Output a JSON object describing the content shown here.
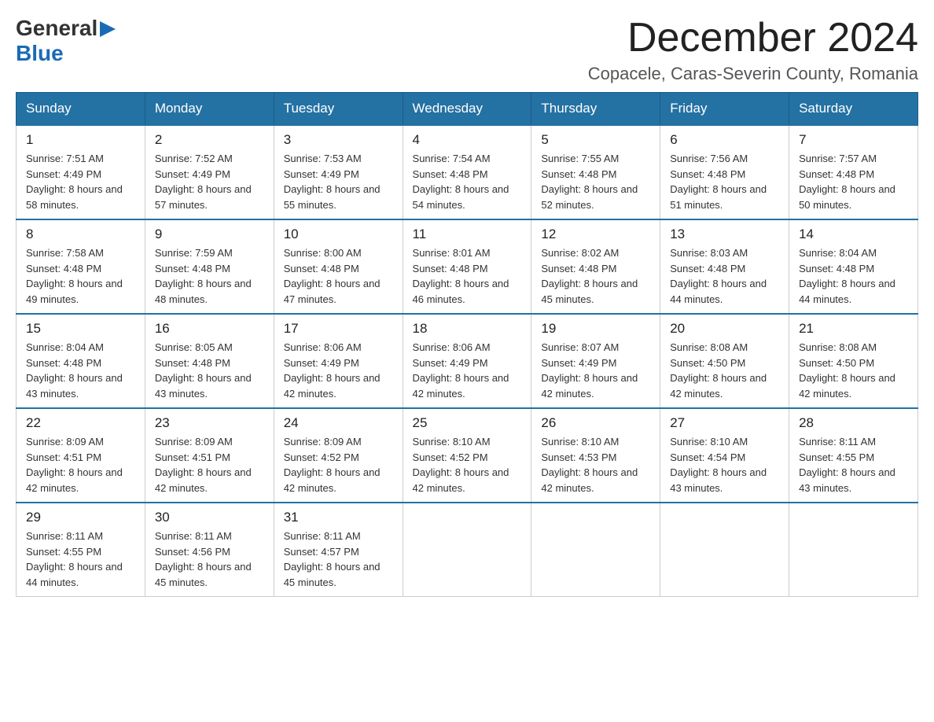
{
  "header": {
    "logo_general": "General",
    "logo_blue": "Blue",
    "month_title": "December 2024",
    "location": "Copacele, Caras-Severin County, Romania"
  },
  "weekdays": [
    "Sunday",
    "Monday",
    "Tuesday",
    "Wednesday",
    "Thursday",
    "Friday",
    "Saturday"
  ],
  "weeks": [
    [
      {
        "day": "1",
        "sunrise": "Sunrise: 7:51 AM",
        "sunset": "Sunset: 4:49 PM",
        "daylight": "Daylight: 8 hours and 58 minutes."
      },
      {
        "day": "2",
        "sunrise": "Sunrise: 7:52 AM",
        "sunset": "Sunset: 4:49 PM",
        "daylight": "Daylight: 8 hours and 57 minutes."
      },
      {
        "day": "3",
        "sunrise": "Sunrise: 7:53 AM",
        "sunset": "Sunset: 4:49 PM",
        "daylight": "Daylight: 8 hours and 55 minutes."
      },
      {
        "day": "4",
        "sunrise": "Sunrise: 7:54 AM",
        "sunset": "Sunset: 4:48 PM",
        "daylight": "Daylight: 8 hours and 54 minutes."
      },
      {
        "day": "5",
        "sunrise": "Sunrise: 7:55 AM",
        "sunset": "Sunset: 4:48 PM",
        "daylight": "Daylight: 8 hours and 52 minutes."
      },
      {
        "day": "6",
        "sunrise": "Sunrise: 7:56 AM",
        "sunset": "Sunset: 4:48 PM",
        "daylight": "Daylight: 8 hours and 51 minutes."
      },
      {
        "day": "7",
        "sunrise": "Sunrise: 7:57 AM",
        "sunset": "Sunset: 4:48 PM",
        "daylight": "Daylight: 8 hours and 50 minutes."
      }
    ],
    [
      {
        "day": "8",
        "sunrise": "Sunrise: 7:58 AM",
        "sunset": "Sunset: 4:48 PM",
        "daylight": "Daylight: 8 hours and 49 minutes."
      },
      {
        "day": "9",
        "sunrise": "Sunrise: 7:59 AM",
        "sunset": "Sunset: 4:48 PM",
        "daylight": "Daylight: 8 hours and 48 minutes."
      },
      {
        "day": "10",
        "sunrise": "Sunrise: 8:00 AM",
        "sunset": "Sunset: 4:48 PM",
        "daylight": "Daylight: 8 hours and 47 minutes."
      },
      {
        "day": "11",
        "sunrise": "Sunrise: 8:01 AM",
        "sunset": "Sunset: 4:48 PM",
        "daylight": "Daylight: 8 hours and 46 minutes."
      },
      {
        "day": "12",
        "sunrise": "Sunrise: 8:02 AM",
        "sunset": "Sunset: 4:48 PM",
        "daylight": "Daylight: 8 hours and 45 minutes."
      },
      {
        "day": "13",
        "sunrise": "Sunrise: 8:03 AM",
        "sunset": "Sunset: 4:48 PM",
        "daylight": "Daylight: 8 hours and 44 minutes."
      },
      {
        "day": "14",
        "sunrise": "Sunrise: 8:04 AM",
        "sunset": "Sunset: 4:48 PM",
        "daylight": "Daylight: 8 hours and 44 minutes."
      }
    ],
    [
      {
        "day": "15",
        "sunrise": "Sunrise: 8:04 AM",
        "sunset": "Sunset: 4:48 PM",
        "daylight": "Daylight: 8 hours and 43 minutes."
      },
      {
        "day": "16",
        "sunrise": "Sunrise: 8:05 AM",
        "sunset": "Sunset: 4:48 PM",
        "daylight": "Daylight: 8 hours and 43 minutes."
      },
      {
        "day": "17",
        "sunrise": "Sunrise: 8:06 AM",
        "sunset": "Sunset: 4:49 PM",
        "daylight": "Daylight: 8 hours and 42 minutes."
      },
      {
        "day": "18",
        "sunrise": "Sunrise: 8:06 AM",
        "sunset": "Sunset: 4:49 PM",
        "daylight": "Daylight: 8 hours and 42 minutes."
      },
      {
        "day": "19",
        "sunrise": "Sunrise: 8:07 AM",
        "sunset": "Sunset: 4:49 PM",
        "daylight": "Daylight: 8 hours and 42 minutes."
      },
      {
        "day": "20",
        "sunrise": "Sunrise: 8:08 AM",
        "sunset": "Sunset: 4:50 PM",
        "daylight": "Daylight: 8 hours and 42 minutes."
      },
      {
        "day": "21",
        "sunrise": "Sunrise: 8:08 AM",
        "sunset": "Sunset: 4:50 PM",
        "daylight": "Daylight: 8 hours and 42 minutes."
      }
    ],
    [
      {
        "day": "22",
        "sunrise": "Sunrise: 8:09 AM",
        "sunset": "Sunset: 4:51 PM",
        "daylight": "Daylight: 8 hours and 42 minutes."
      },
      {
        "day": "23",
        "sunrise": "Sunrise: 8:09 AM",
        "sunset": "Sunset: 4:51 PM",
        "daylight": "Daylight: 8 hours and 42 minutes."
      },
      {
        "day": "24",
        "sunrise": "Sunrise: 8:09 AM",
        "sunset": "Sunset: 4:52 PM",
        "daylight": "Daylight: 8 hours and 42 minutes."
      },
      {
        "day": "25",
        "sunrise": "Sunrise: 8:10 AM",
        "sunset": "Sunset: 4:52 PM",
        "daylight": "Daylight: 8 hours and 42 minutes."
      },
      {
        "day": "26",
        "sunrise": "Sunrise: 8:10 AM",
        "sunset": "Sunset: 4:53 PM",
        "daylight": "Daylight: 8 hours and 42 minutes."
      },
      {
        "day": "27",
        "sunrise": "Sunrise: 8:10 AM",
        "sunset": "Sunset: 4:54 PM",
        "daylight": "Daylight: 8 hours and 43 minutes."
      },
      {
        "day": "28",
        "sunrise": "Sunrise: 8:11 AM",
        "sunset": "Sunset: 4:55 PM",
        "daylight": "Daylight: 8 hours and 43 minutes."
      }
    ],
    [
      {
        "day": "29",
        "sunrise": "Sunrise: 8:11 AM",
        "sunset": "Sunset: 4:55 PM",
        "daylight": "Daylight: 8 hours and 44 minutes."
      },
      {
        "day": "30",
        "sunrise": "Sunrise: 8:11 AM",
        "sunset": "Sunset: 4:56 PM",
        "daylight": "Daylight: 8 hours and 45 minutes."
      },
      {
        "day": "31",
        "sunrise": "Sunrise: 8:11 AM",
        "sunset": "Sunset: 4:57 PM",
        "daylight": "Daylight: 8 hours and 45 minutes."
      },
      null,
      null,
      null,
      null
    ]
  ]
}
